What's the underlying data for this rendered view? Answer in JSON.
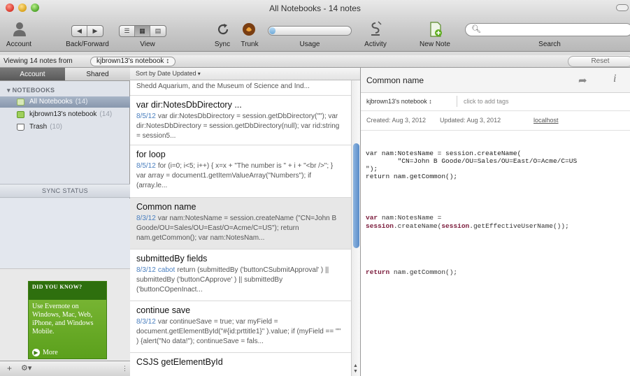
{
  "window": {
    "title": "All Notebooks - 14 notes"
  },
  "toolbar": {
    "account_label": "Account",
    "backforward_label": "Back/Forward",
    "view_label": "View",
    "sync_label": "Sync",
    "trunk_label": "Trunk",
    "usage_label": "Usage",
    "usage_fill": 0.08,
    "activity_label": "Activity",
    "new_note_label": "New Note",
    "search_label": "Search",
    "search_value": ""
  },
  "viewbar": {
    "prefix": "Viewing 14 notes from",
    "notebook": "kjbrown13's notebook",
    "reset_label": "Reset"
  },
  "sidebar": {
    "tabs": [
      "Account",
      "Shared"
    ],
    "notebooks_header": "NOTEBOOKS",
    "items": [
      {
        "label": "All Notebooks",
        "count": "(14)"
      },
      {
        "label": "kjbrown13's notebook",
        "count": "(14)"
      },
      {
        "label": "Trash",
        "count": "(10)"
      }
    ],
    "sync_status": "SYNC STATUS",
    "ad": {
      "top": "DID YOU KNOW?",
      "body": "Use Evernote on Windows, Mac, Web, iPhone, and Windows Mobile.",
      "more": "More"
    }
  },
  "notelist": {
    "sort_label": "Sort by Date Updated",
    "notes": [
      {
        "title": "",
        "date": "",
        "author": "",
        "snippet": "Shedd Aquarium, and the Museum of Science and Ind..."
      },
      {
        "title": "var dir:NotesDbDirectory ...",
        "date": "8/5/12",
        "author": "",
        "snippet": "var dir:NotesDbDirectory = session.getDbDirectory(\"\"); var dir:NotesDbDirectory = session.getDbDirectory(null); var rid:string = session5..."
      },
      {
        "title": "for loop",
        "date": "8/5/12",
        "author": "",
        "snippet": "for (i=0; i<5; i++) { x=x + \"The number is \" + i + \"<br />\"; } var array = document1.getItemValueArray(\"Numbers\"); if (array.le..."
      },
      {
        "title": "Common name",
        "date": "8/3/12",
        "author": "",
        "snippet": "var nam:NotesName = session.createName (\"CN=John B Goode/OU=Sales/OU=East/O=Acme/C=US\"); return nam.getCommon(); var nam:NotesNam..."
      },
      {
        "title": "submittedBy fields",
        "date": "8/3/12",
        "author": "cabot",
        "snippet": "return (submittedBy ('buttonCSubmitApproval' ) || submittedBy ('buttonCApprove' ) || submittedBy ('buttonCOpenInact..."
      },
      {
        "title": "continue save",
        "date": "8/3/12",
        "author": "",
        "snippet": "var continueSave = true; var myField = document.getElementById(\"#{id:prttitle1}\" ).value; if (myField == \"\" ) {alert(\"No data!\"); continueSave = fals..."
      },
      {
        "title": "CSJS getElementById",
        "date": "",
        "author": "",
        "snippet": ""
      }
    ]
  },
  "editor": {
    "title": "Common name",
    "notebook": "kjbrown13's notebook",
    "tags_placeholder": "click to add tags",
    "created": "Created: Aug 3, 2012",
    "updated": "Updated: Aug 3, 2012",
    "source": "localhost",
    "code_block_1": "var nam:NotesName = session.createName(\n        \"CN=John B Goode/OU=Sales/OU=East/O=Acme/C=US\n\");\nreturn nam.getCommon();",
    "code_block_2_line1": "var nam:NotesName =",
    "code_block_2_line2": "session.createName(session.getEffectiveUserName());",
    "code_block_3": "return nam.getCommon();"
  }
}
